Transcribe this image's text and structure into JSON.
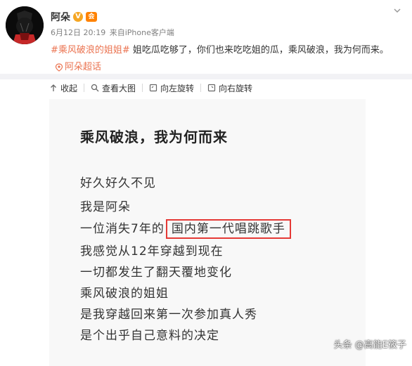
{
  "post": {
    "username": "阿朵",
    "vip_badge": "V",
    "member_badge": "会",
    "timestamp": "6月12日 20:19",
    "source": "来自iPhone客户端",
    "hashtag": "#乘风破浪的姐姐#",
    "text": " 姐吃瓜吃够了，你们也来吃吃姐的瓜，乘风破浪，我为何而来。",
    "supertopic": "阿朵超话"
  },
  "toolbar": {
    "collapse": "收起",
    "view_large": "查看大图",
    "rotate_left": "向左旋转",
    "rotate_right": "向右旋转"
  },
  "image_card": {
    "title": "乘风破浪，我为何而来",
    "lines": [
      "好久好久不见",
      "我是阿朵",
      "一位消失7年的",
      "我感觉从12年穿越到现在",
      "一切都发生了翻天覆地变化",
      "乘风破浪的姐姐",
      "是我穿越回来第一次参加真人秀",
      "是个出乎自己意料的决定"
    ],
    "highlight": "国内第一代唱跳歌手",
    "highlight_color": "#e53935"
  },
  "watermark": "头条 @高能E筱子",
  "colors": {
    "accent": "#eb7350",
    "divider": "#f2f2f5",
    "card_bg": "#f8f8f8"
  },
  "icons": [
    "avatar",
    "vip-badge",
    "member-badge",
    "chevron-down-icon",
    "supertopic-icon",
    "collapse-icon",
    "zoom-icon",
    "rotate-left-icon",
    "rotate-right-icon"
  ]
}
